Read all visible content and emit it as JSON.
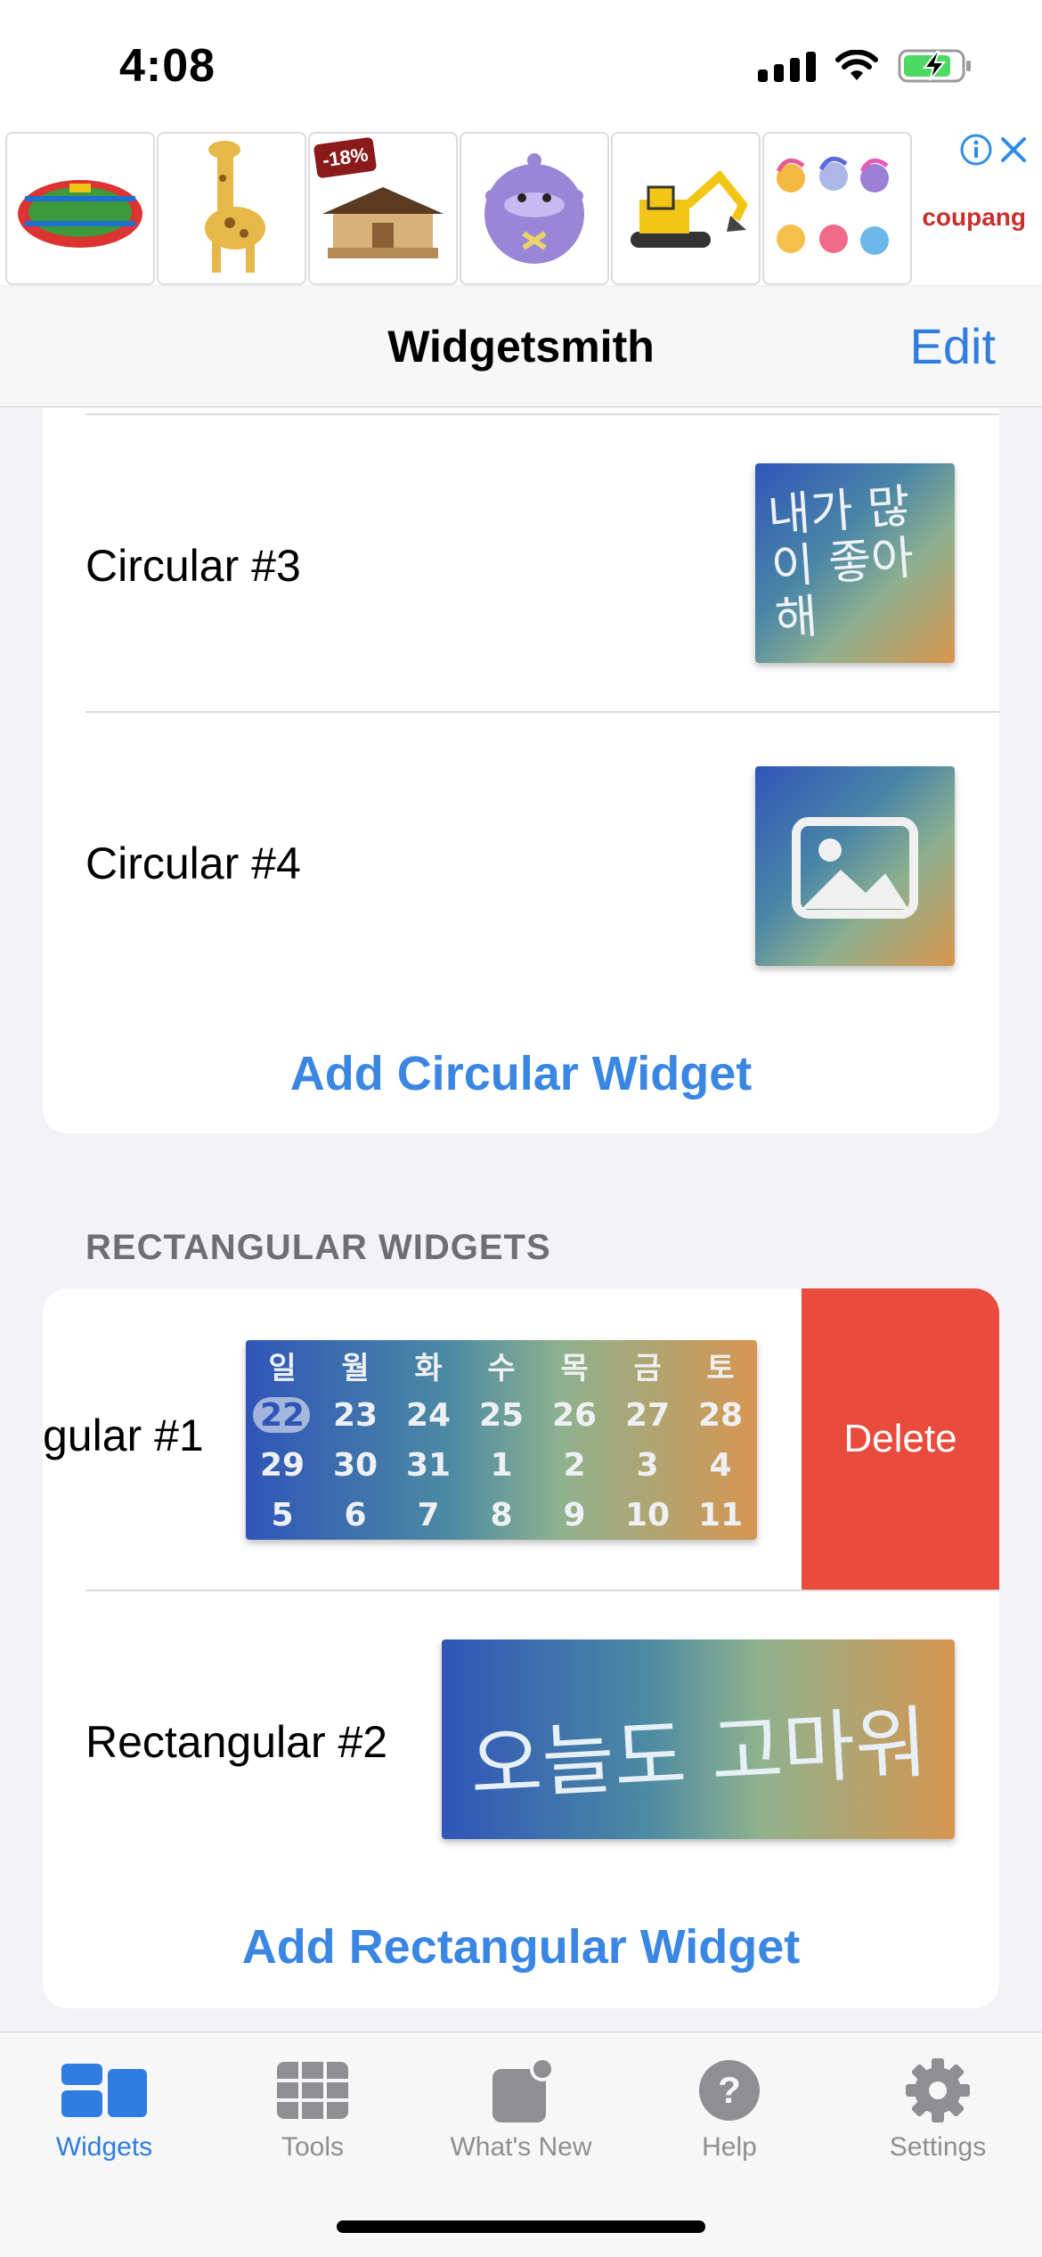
{
  "status_bar": {
    "time": "4:08"
  },
  "ad": {
    "discount_badge": "-18%",
    "brand": "coupang",
    "tiles": [
      {
        "icon": "foosball-toy-icon"
      },
      {
        "icon": "giraffe-toy-icon"
      },
      {
        "icon": "wooden-house-model-icon"
      },
      {
        "icon": "purple-plush-icon"
      },
      {
        "icon": "excavator-toy-icon"
      },
      {
        "icon": "pony-figures-icon"
      }
    ]
  },
  "nav": {
    "title": "Widgetsmith",
    "edit_label": "Edit"
  },
  "circular": {
    "rows": [
      {
        "label": "Circular #3",
        "thumb_text": "내가 많이 좋아해"
      },
      {
        "label": "Circular #4"
      }
    ],
    "add_label": "Add Circular Widget"
  },
  "rectangular": {
    "section_header": "RECTANGULAR WIDGETS",
    "rows": [
      {
        "label": "gular #1"
      },
      {
        "label": "Rectangular #2",
        "thumb_text": "오늘도 고마워"
      }
    ],
    "delete_label": "Delete",
    "add_label": "Add Rectangular Widget"
  },
  "calendar": {
    "weekdays": [
      "일",
      "월",
      "화",
      "수",
      "목",
      "금",
      "토"
    ],
    "weeks": [
      [
        "22",
        "23",
        "24",
        "25",
        "26",
        "27",
        "28"
      ],
      [
        "29",
        "30",
        "31",
        "1",
        "2",
        "3",
        "4"
      ],
      [
        "5",
        "6",
        "7",
        "8",
        "9",
        "10",
        "11"
      ]
    ],
    "today": "22"
  },
  "tabs": [
    {
      "label": "Widgets",
      "icon": "widgets-icon",
      "active": true
    },
    {
      "label": "Tools",
      "icon": "tools-grid-icon"
    },
    {
      "label": "What's New",
      "icon": "whats-new-icon"
    },
    {
      "label": "Help",
      "icon": "help-icon"
    },
    {
      "label": "Settings",
      "icon": "gear-icon"
    }
  ],
  "colors": {
    "accent": "#2f7de1",
    "delete": "#e94b3c",
    "background": "#f2f2f7"
  }
}
